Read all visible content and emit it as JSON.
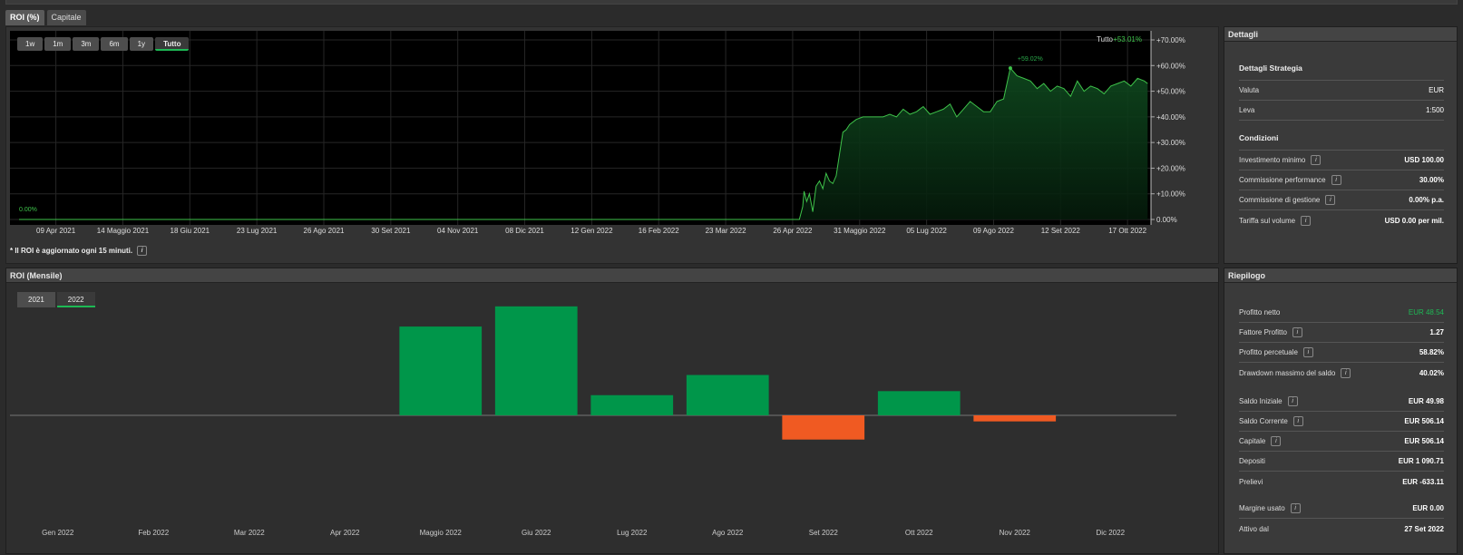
{
  "tabs": [
    {
      "label": "ROI (%)",
      "active": true
    },
    {
      "label": "Capitale",
      "active": false
    }
  ],
  "roi": {
    "ranges": [
      "1w",
      "1m",
      "3m",
      "6m",
      "1y",
      "Tutto"
    ],
    "active_range": "Tutto",
    "legend_label": "Tutto",
    "legend_value": "+53.01%",
    "start_label": "0.00%",
    "peak_label": "+59.02%",
    "footnote": "* Il ROI è aggiornato ogni 15 minuti.",
    "colors": {
      "line": "#3ec24a",
      "peak": "#2aa84a",
      "grid": "#262626"
    }
  },
  "monthly_panel": {
    "title": "ROI (Mensile)",
    "years": [
      "2021",
      "2022"
    ],
    "active_year": "2022",
    "colors": {
      "positive": "#00964a",
      "negative": "#f05a22"
    }
  },
  "details": {
    "title": "Dettagli",
    "strategy_title": "Dettagli Strategia",
    "strategy_rows": [
      {
        "label": "Valuta",
        "value": "EUR"
      },
      {
        "label": "Leva",
        "value": "1:500"
      }
    ],
    "conditions_title": "Condizioni",
    "condition_rows": [
      {
        "label": "Investimento minimo",
        "value": "USD 100.00"
      },
      {
        "label": "Commissione performance",
        "value": "30.00%"
      },
      {
        "label": "Commissione di gestione",
        "value": "0.00% p.a."
      },
      {
        "label": "Tariffa sul volume",
        "value": "USD 0.00 per mil."
      }
    ]
  },
  "summary": {
    "title": "Riepilogo",
    "profit_label": "Profitto netto",
    "profit_value": "EUR 48.54",
    "rows": [
      {
        "label": "Fattore Profitto",
        "value": "1.27"
      },
      {
        "label": "Profitto percetuale",
        "value": "58.82%"
      },
      {
        "label": "Drawdown massimo del saldo",
        "value": "40.02%"
      }
    ],
    "balance_rows": [
      {
        "label": "Saldo Iniziale",
        "value": "EUR 49.98"
      },
      {
        "label": "Saldo Corrente",
        "value": "EUR 506.14"
      },
      {
        "label": "Capitale",
        "value": "EUR 506.14"
      },
      {
        "label": "Depositi",
        "value": "EUR 1 090.71"
      },
      {
        "label": "Prelievi",
        "value": "EUR -633.11"
      }
    ],
    "margin_label": "Margine usato",
    "margin_value": "EUR 0.00",
    "active_label": "Attivo dal",
    "active_value": "27 Set 2022"
  },
  "chart_data": [
    {
      "type": "line",
      "ylim": [
        0,
        70
      ],
      "ytick_labels": [
        "0.00%",
        "+10.00%",
        "+20.00%",
        "+30.00%",
        "+40.00%",
        "+50.00%",
        "+60.00%",
        "+70.00%"
      ],
      "ytick_values": [
        0,
        10,
        20,
        30,
        40,
        50,
        60,
        70
      ],
      "x_labels": [
        "09 Apr 2021",
        "14 Maggio 2021",
        "18 Giu 2021",
        "23 Lug 2021",
        "26 Ago 2021",
        "30 Set 2021",
        "04 Nov 2021",
        "08 Dic 2021",
        "12 Gen 2022",
        "16 Feb 2022",
        "23 Mar 2022",
        "26 Apr 2022",
        "31 Maggio 2022",
        "05 Lug 2022",
        "09 Ago 2022",
        "12 Set 2022",
        "17 Ott 2022"
      ],
      "series": [
        {
          "x": [
            0,
            2,
            4,
            6,
            8,
            10,
            11.65,
            11.7,
            11.72,
            11.76,
            11.8,
            11.85,
            11.9,
            11.95,
            12.0,
            12.05,
            12.1,
            12.15,
            12.2,
            12.3,
            12.35,
            12.4,
            12.5,
            12.6,
            12.7,
            12.8,
            12.9,
            13.0,
            13.1,
            13.2,
            13.3,
            13.4,
            13.5,
            13.6,
            13.7,
            13.8,
            13.9,
            14.0,
            14.1,
            14.2,
            14.3,
            14.4,
            14.5,
            14.6,
            14.7,
            14.75,
            14.8,
            14.9,
            15.0,
            15.1,
            15.2,
            15.3,
            15.4,
            15.5,
            15.6,
            15.7,
            15.8,
            15.9,
            16.0,
            16.1,
            16.2,
            16.3,
            16.4,
            16.5,
            16.6,
            16.7,
            16.8,
            16.85
          ],
          "y": [
            0,
            0,
            0,
            0,
            0,
            0,
            0,
            5,
            11,
            7,
            10,
            3,
            13,
            15,
            12,
            18,
            15,
            14,
            17,
            34,
            35,
            37,
            39,
            40,
            40,
            40,
            40,
            41,
            40,
            43,
            41,
            42,
            44,
            41,
            42,
            43,
            45,
            40,
            43,
            46,
            44,
            42,
            42,
            46,
            47,
            53,
            59,
            56,
            55,
            54,
            51,
            53,
            50,
            52,
            51,
            48,
            54,
            50,
            52,
            51,
            49,
            52,
            53,
            54,
            52,
            55,
            54,
            53
          ]
        }
      ]
    },
    {
      "type": "bar",
      "categories": [
        "Gen 2022",
        "Feb 2022",
        "Mar 2022",
        "Apr 2022",
        "Maggio 2022",
        "Giu 2022",
        "Lug 2022",
        "Ago 2022",
        "Set 2022",
        "Ott 2022",
        "Nov 2022",
        "Dic 2022"
      ],
      "values": [
        0,
        0,
        0,
        0,
        22,
        27,
        5,
        10,
        -6,
        6,
        -1.5,
        0
      ]
    }
  ]
}
